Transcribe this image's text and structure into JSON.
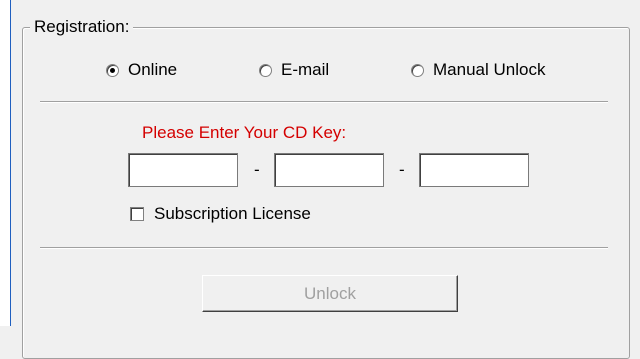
{
  "group": {
    "legend": "Registration:"
  },
  "registration_method": {
    "options": [
      {
        "label": "Online",
        "selected": true
      },
      {
        "label": "E-mail",
        "selected": false
      },
      {
        "label": "Manual Unlock",
        "selected": false
      }
    ]
  },
  "cd_key": {
    "prompt": "Please Enter Your CD Key:",
    "prompt_color": "#d40000",
    "segments": [
      "",
      "",
      ""
    ],
    "separator": "-"
  },
  "subscription": {
    "label": "Subscription License",
    "checked": false
  },
  "actions": {
    "unlock_label": "Unlock",
    "unlock_enabled": false
  }
}
